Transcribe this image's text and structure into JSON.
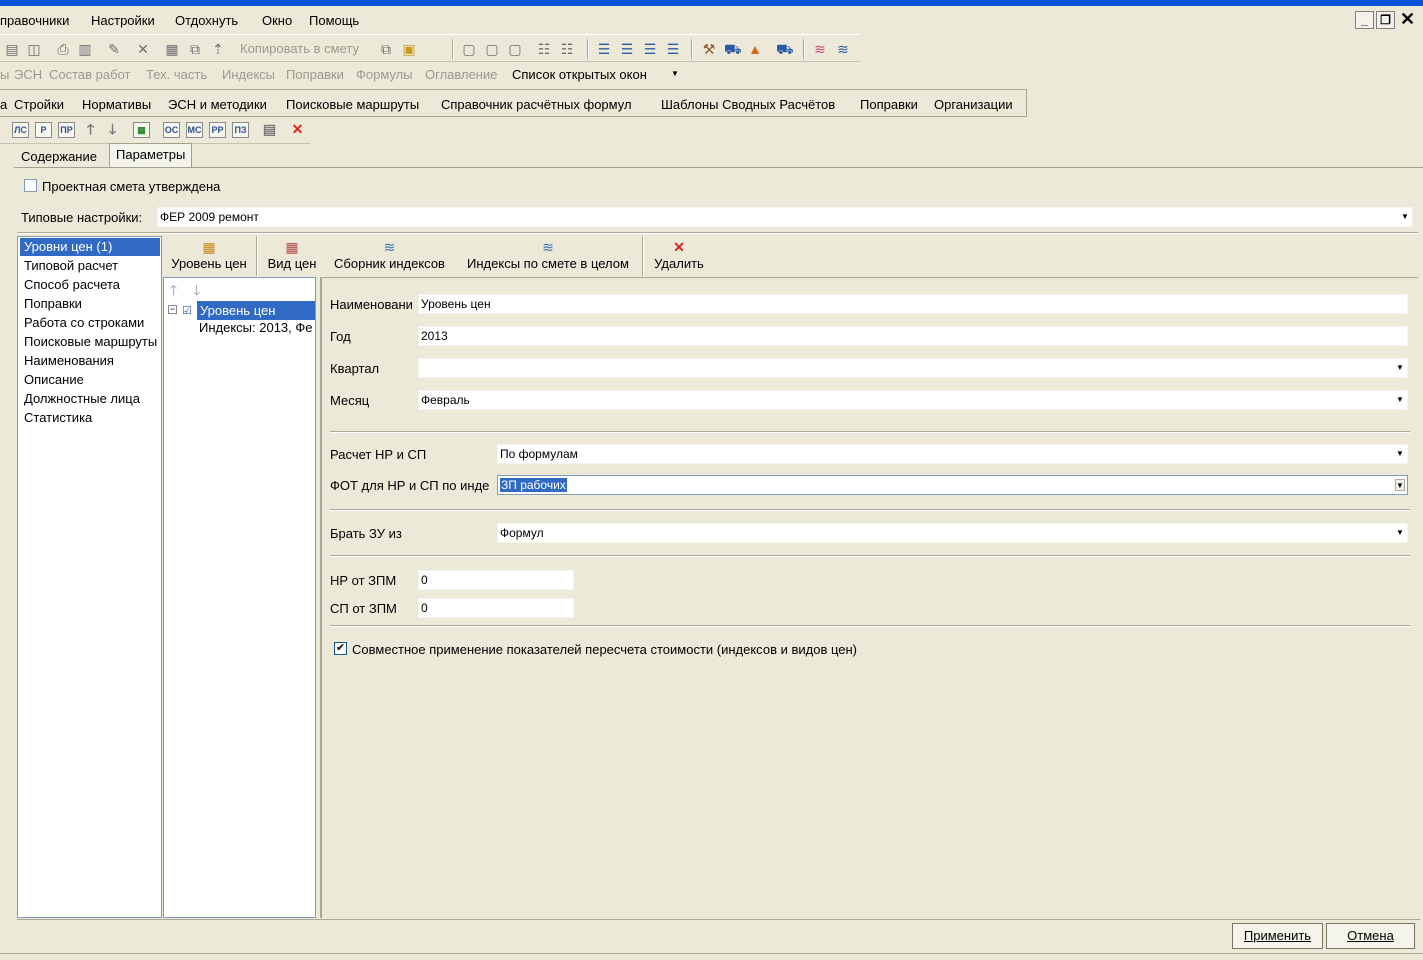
{
  "menu": {
    "items": [
      "правочники",
      "Настройки",
      "Отдохнуть",
      "Окно",
      "Помощь"
    ]
  },
  "toolbar": {
    "copy_to_estimate": "Копировать в смету"
  },
  "window_tabs": {
    "items": [
      "ы",
      "ЭСН",
      "Состав работ",
      "Тех. часть",
      "Индексы",
      "Поправки",
      "Формулы",
      "Оглавление"
    ],
    "open_windows": "Список открытых окон"
  },
  "nav": {
    "items": [
      "а",
      "Стройки",
      "Нормативы",
      "ЭСН и методики",
      "Поисковые маршруты",
      "Справочник расчётных формул",
      "Шаблоны Сводных Расчётов",
      "Поправки",
      "Организации"
    ]
  },
  "tabs": {
    "content": "Содержание",
    "params": "Параметры"
  },
  "approved": {
    "label": "Проектная смета утверждена",
    "checked": false
  },
  "typical": {
    "label": "Типовые настройки:",
    "value": "ФЕР 2009 ремонт"
  },
  "left_list": {
    "items": [
      "Уровни цен (1)",
      "Типовой расчет",
      "Способ расчета",
      "Поправки",
      "Работа со строками",
      "Поисковые маршруты",
      "Наименования",
      "Описание",
      "Должностные лица",
      "Статистика"
    ]
  },
  "buttons": {
    "price_level": "Уровень цен",
    "price_type": "Вид цен",
    "index_collection": "Сборник индексов",
    "indexes_whole": "Индексы по смете в целом",
    "delete": "Удалить"
  },
  "tree": {
    "root": "Уровень цен",
    "child": "Индексы: 2013, Фе"
  },
  "form": {
    "name_label": "Наименовани",
    "name_value": "Уровень цен",
    "year_label": "Год",
    "year_value": "2013",
    "quarter_label": "Квартал",
    "quarter_value": "",
    "month_label": "Месяц",
    "month_value": "Февраль",
    "calc_label": "Расчет НР и СП",
    "calc_value": "По формулам",
    "fot_label": "ФОТ для НР и СП по инде",
    "fot_value": "ЗП рабочих",
    "zu_label": "Брать ЗУ из",
    "zu_value": "Формул",
    "nr_label": "НР от ЗПМ",
    "nr_value": "0",
    "sp_label": "СП от ЗПМ",
    "sp_value": "0",
    "joint_label": "Совместное применение показателей пересчета стоимости (индексов и видов цен)",
    "joint_checked": true
  },
  "footer": {
    "apply": "Применить",
    "cancel": "Отмена"
  },
  "colors": {
    "background": "#ece9d8",
    "selection": "#316ac5"
  }
}
